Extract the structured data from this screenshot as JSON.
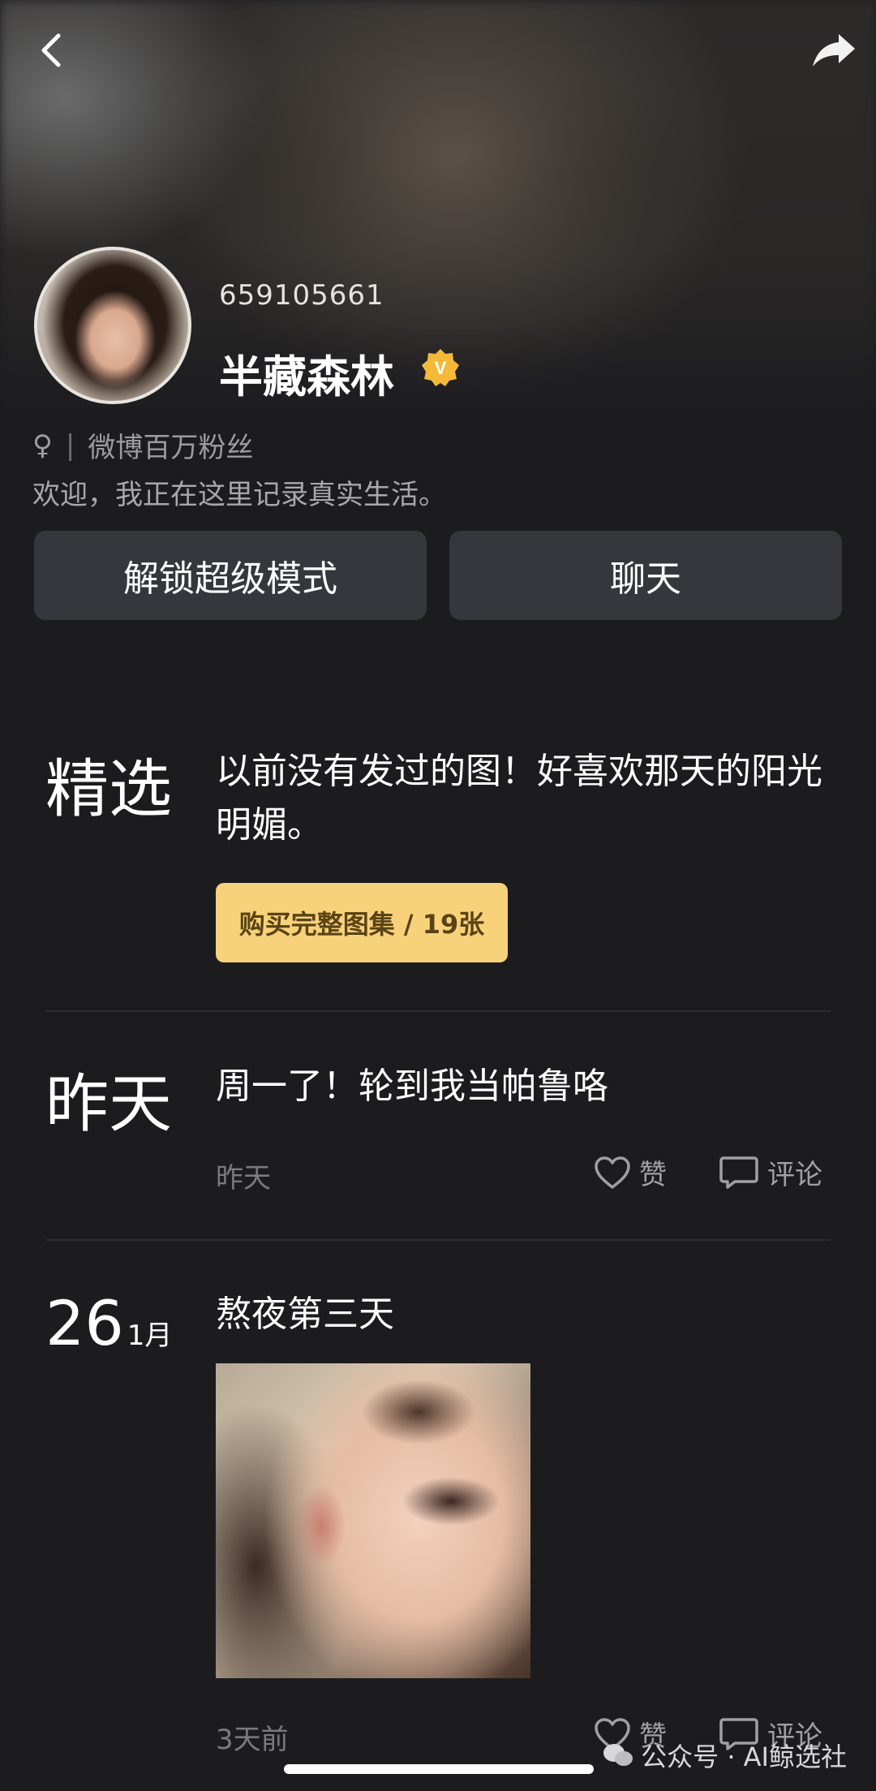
{
  "header": {
    "back_icon": "back-icon",
    "share_icon": "share-icon"
  },
  "profile": {
    "user_id": "659105661",
    "name": "半藏森林",
    "verified_badge": "V",
    "gender_icon": "♀",
    "separator": "|",
    "tagline": "微博百万粉丝",
    "bio": "欢迎，我正在这里记录真实生活。"
  },
  "actions": {
    "unlock_label": "解锁超级模式",
    "chat_label": "聊天"
  },
  "feed": [
    {
      "date_label": "精选",
      "text": "以前没有发过的图！好喜欢那天的阳光明媚。",
      "buy_label": "购买完整图集 / 19张"
    },
    {
      "date_label": "昨天",
      "text": "周一了！轮到我当帕鲁咯",
      "time": "昨天",
      "like_label": "赞",
      "comment_label": "评论"
    },
    {
      "date_day": "26",
      "date_month": "1月",
      "text": "熬夜第三天",
      "time": "3天前",
      "like_label": "赞",
      "comment_label": "评论"
    }
  ],
  "watermark": {
    "text": "公众号 · AI鲸选社"
  },
  "colors": {
    "background": "#1c1c1f",
    "button": "#36373c",
    "buy_button": "#f8d27a",
    "badge": "#f5b93a"
  }
}
